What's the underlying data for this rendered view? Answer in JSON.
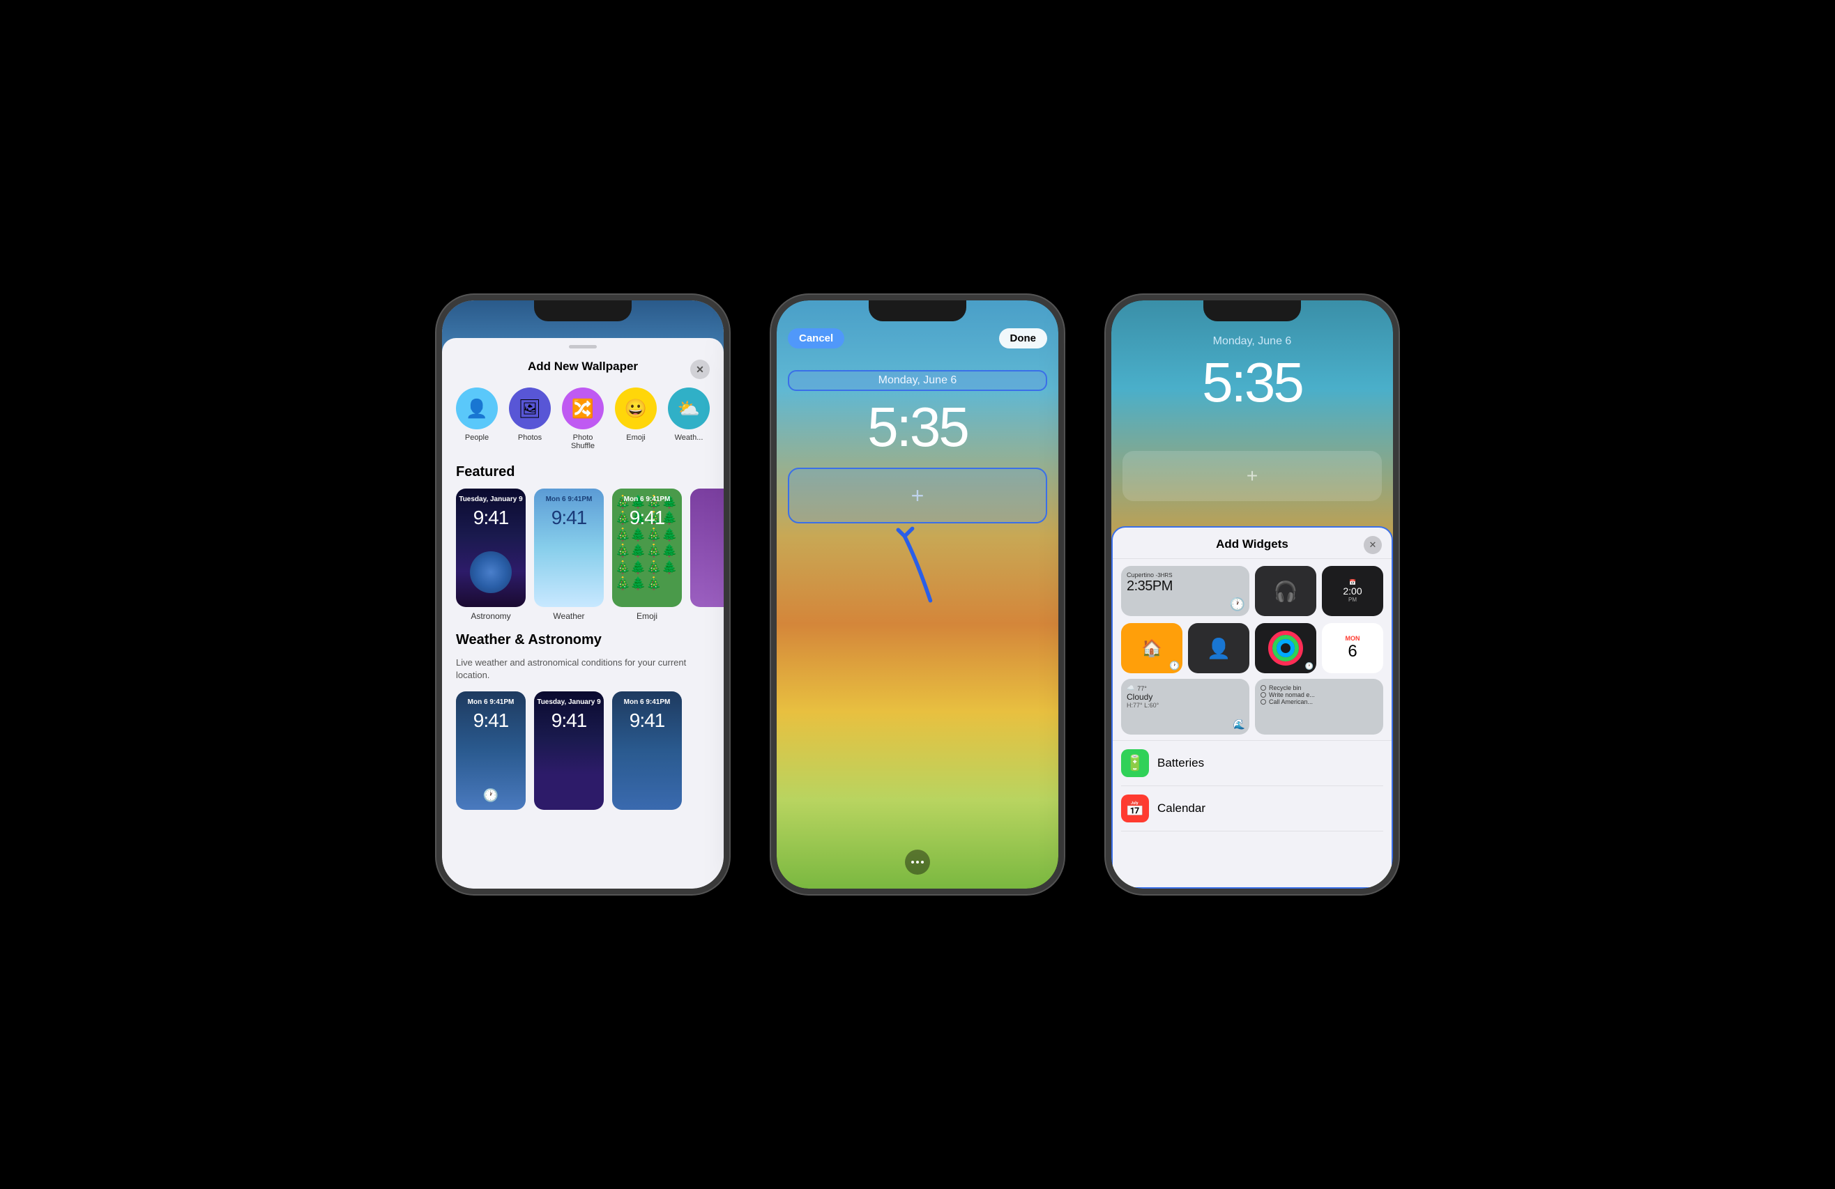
{
  "phones": [
    {
      "id": "phone1",
      "modal": {
        "title": "Add New Wallpaper",
        "options": [
          {
            "label": "People",
            "icon": "👤",
            "bg": "#5ac8fa"
          },
          {
            "label": "Photos",
            "icon": "🖼",
            "bg": "#5856d6"
          },
          {
            "label": "Photo\nShuffle",
            "icon": "🔀",
            "bg": "#bf5af2"
          },
          {
            "label": "Emoji",
            "icon": "😀",
            "bg": "#ffd60a"
          },
          {
            "label": "Weath...",
            "icon": "⛅",
            "bg": "#30b0c7"
          }
        ],
        "sections": [
          {
            "title": "Featured",
            "items": [
              {
                "label": "Astronomy",
                "style": "astronomy"
              },
              {
                "label": "Weather",
                "style": "weather"
              },
              {
                "label": "Emoji",
                "style": "emoji"
              }
            ]
          },
          {
            "title": "Weather & Astronomy",
            "desc": "Live weather and astronomical conditions for your current location.",
            "items": [
              {
                "style": "wt1"
              },
              {
                "style": "wt2"
              },
              {
                "style": "wt3"
              }
            ]
          }
        ]
      }
    },
    {
      "id": "phone2",
      "date": "Monday, June 6",
      "time": "5:35",
      "buttons": {
        "cancel": "Cancel",
        "done": "Done"
      }
    },
    {
      "id": "phone3",
      "date": "Monday, June 6",
      "time": "5:35",
      "panel": {
        "title": "Add Widgets",
        "widgets": {
          "row1": [
            {
              "type": "weather-large",
              "city": "Cupertino",
              "offset": "-3HRS",
              "time": "2:35PM"
            },
            {
              "type": "airpods"
            },
            {
              "type": "clock2",
              "time": "2:00",
              "label": "PM"
            }
          ],
          "row2": [
            {
              "type": "home"
            },
            {
              "type": "user"
            },
            {
              "type": "fitness"
            },
            {
              "type": "calendar",
              "month": "MON",
              "day": "6"
            }
          ],
          "row3": [
            {
              "type": "weather-small",
              "temp": "77°",
              "condition": "Cloudy",
              "hi": "H:77°",
              "lo": "L:60°"
            },
            {
              "type": "reminders",
              "items": [
                "Recycle bin",
                "Write nomad e...",
                "Call American..."
              ]
            }
          ]
        },
        "list": [
          {
            "icon": "🔋",
            "label": "Batteries",
            "color": "green"
          },
          {
            "icon": "📅",
            "label": "Calendar",
            "color": "red"
          }
        ]
      }
    }
  ]
}
